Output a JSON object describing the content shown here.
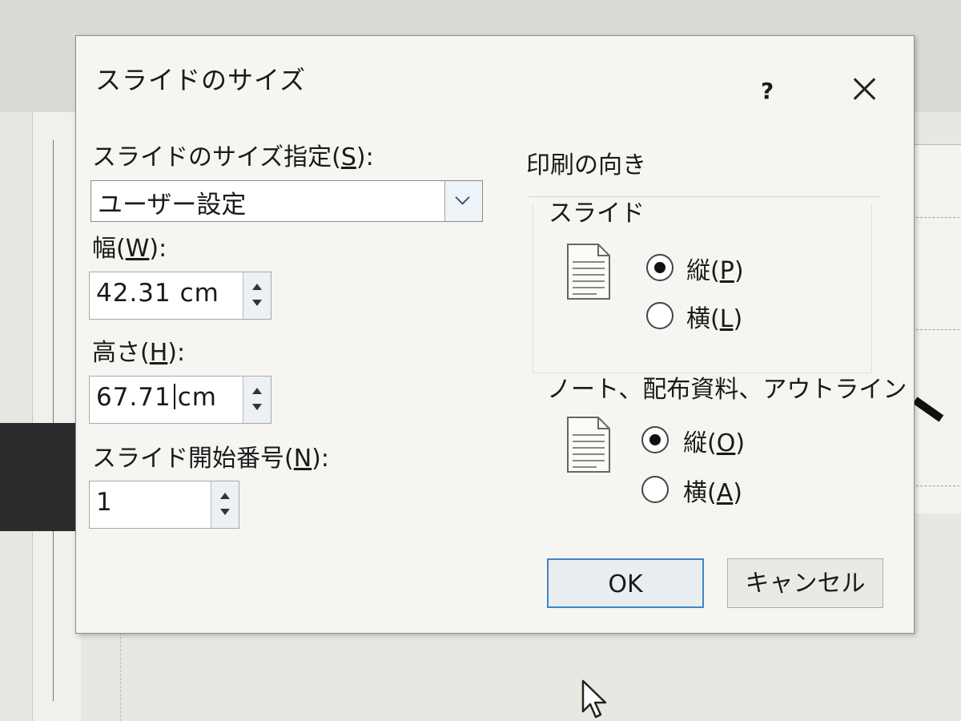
{
  "dialog": {
    "title": "スライドのサイズ",
    "help": "?",
    "size_label_pre": "スライドのサイズ指定(",
    "size_label_key": "S",
    "size_label_post": "):",
    "size_value": "ユーザー設定",
    "width_label_pre": "幅(",
    "width_label_key": "W",
    "width_label_post": "):",
    "width_value": "42.31 cm",
    "height_label_pre": "高さ(",
    "height_label_key": "H",
    "height_label_post": "):",
    "height_value_before_caret": "67.71",
    "height_value_after_caret": "cm",
    "start_label_pre": "スライド開始番号(",
    "start_label_key": "N",
    "start_label_post": "):",
    "start_value": "1",
    "orientation_title": "印刷の向き",
    "slide_group": "スライド",
    "slide_portrait_pre": "縦(",
    "slide_portrait_key": "P",
    "slide_portrait_post": ")",
    "slide_landscape_pre": "横(",
    "slide_landscape_key": "L",
    "slide_landscape_post": ")",
    "notes_group": "ノート、配布資料、アウトライン",
    "notes_portrait_pre": "縦(",
    "notes_portrait_key": "O",
    "notes_portrait_post": ")",
    "notes_landscape_pre": "横(",
    "notes_landscape_key": "A",
    "notes_landscape_post": ")",
    "ok": "OK",
    "cancel": "キャンセル",
    "slide_orientation_selected": "portrait",
    "notes_orientation_selected": "portrait"
  },
  "colors": {
    "ok_border": "#3f86c7"
  }
}
